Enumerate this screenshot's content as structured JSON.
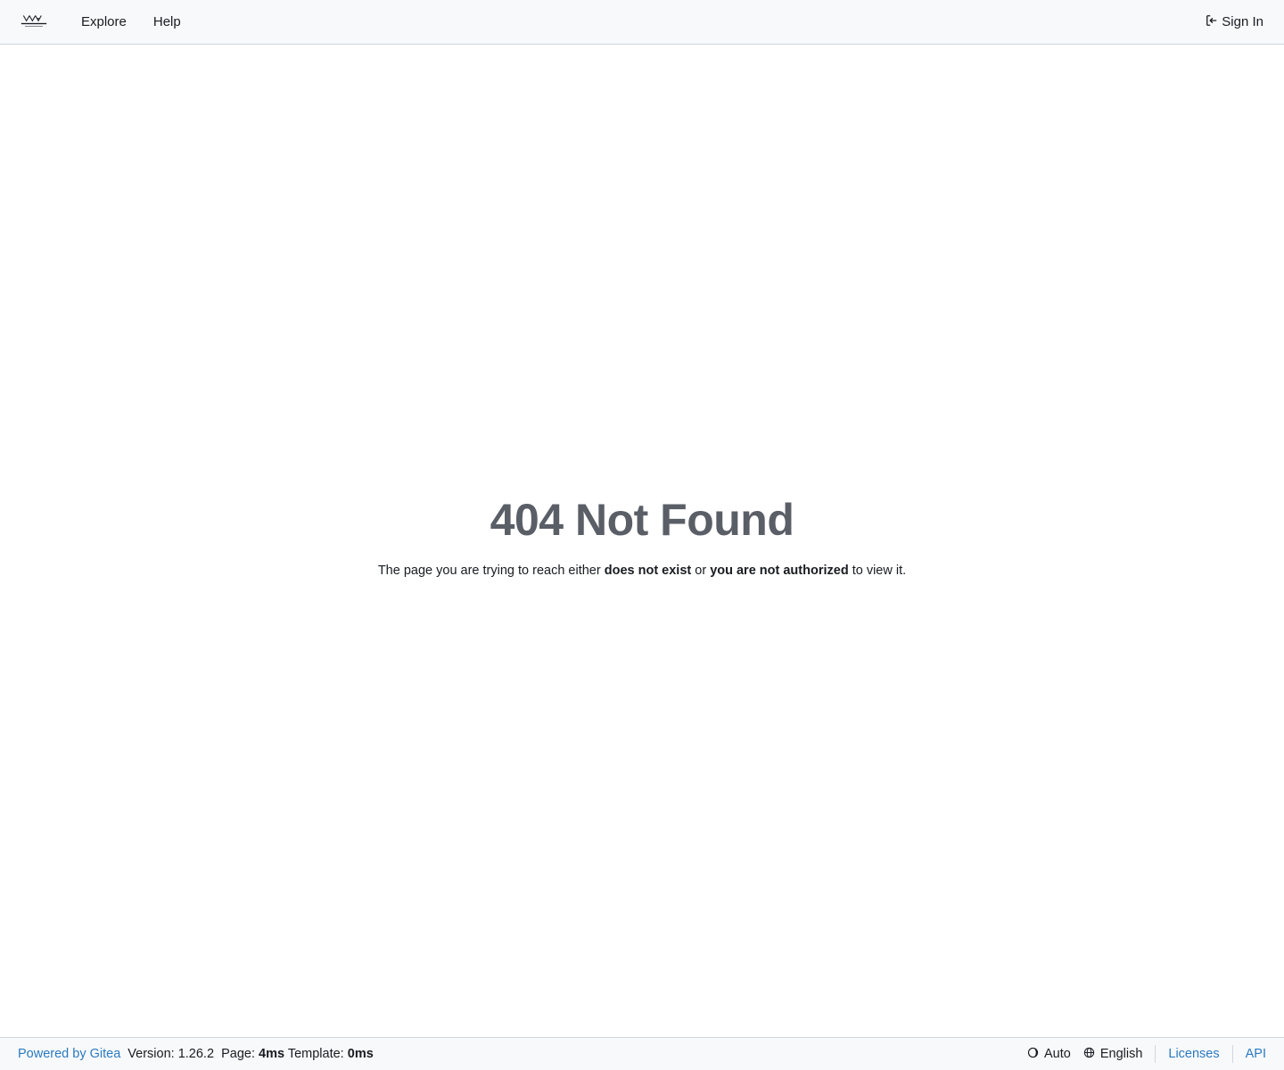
{
  "nav": {
    "logo_icon": "site-logo-icon",
    "items": [
      {
        "label": "Explore"
      },
      {
        "label": "Help"
      }
    ],
    "signin_label": "Sign In"
  },
  "error": {
    "title": "404 Not Found",
    "desc_part1": "The page you are trying to reach either ",
    "desc_bold1": "does not exist",
    "desc_part2": " or ",
    "desc_bold2": "you are not authorized",
    "desc_part3": " to view it."
  },
  "footer": {
    "powered_by": "Powered by Gitea",
    "version_label": "Version:",
    "version_value": "1.26.2",
    "page_label": "Page:",
    "page_value": "4ms",
    "template_label": "Template:",
    "template_value": "0ms",
    "theme_label": "Auto",
    "language_label": "English",
    "licenses_label": "Licenses",
    "api_label": "API"
  },
  "colors": {
    "link": "#2a7ac0",
    "title": "#5a5e66",
    "navbar_bg": "#f8f9fb",
    "border": "#d0d7de"
  }
}
